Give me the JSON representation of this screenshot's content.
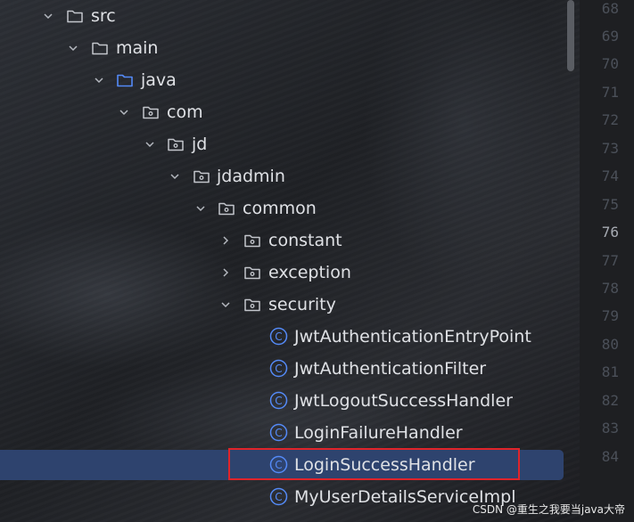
{
  "tree": {
    "folders": [
      "src",
      "main",
      "java",
      "com",
      "jd",
      "jdadmin",
      "common",
      "constant",
      "exception",
      "security"
    ],
    "classes": [
      "JwtAuthenticationEntryPoint",
      "JwtAuthenticationFilter",
      "JwtLogoutSuccessHandler",
      "LoginFailureHandler",
      "LoginSuccessHandler",
      "MyUserDetailsServiceImpl"
    ],
    "selected": "LoginSuccessHandler",
    "highlighted": "LoginSuccessHandler"
  },
  "gutter": {
    "line_numbers": [
      "68",
      "69",
      "70",
      "71",
      "72",
      "73",
      "74",
      "75",
      "76",
      "77",
      "78",
      "79",
      "80",
      "81",
      "82",
      "83",
      "84"
    ],
    "current_line": "76"
  },
  "watermark": "CSDN @重生之我要当java大帝",
  "colors": {
    "panel_bg": "#23252a",
    "selection_bg": "#2e436e",
    "highlight_border": "#e0242a",
    "gutter_bg": "#1e1f22",
    "source_folder_icon": "#548af7",
    "class_icon": "#548af7",
    "text": "#dfe1e5"
  }
}
